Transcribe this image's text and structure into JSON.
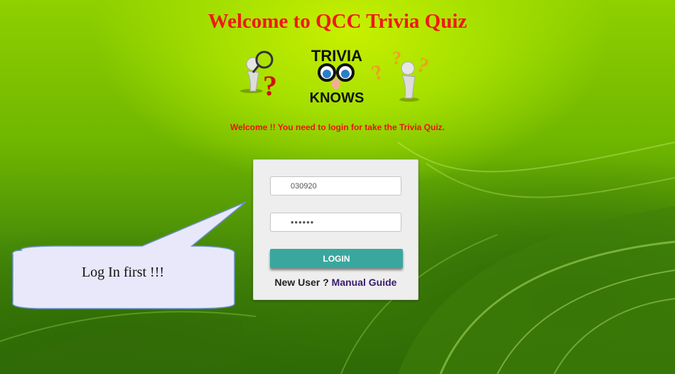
{
  "page": {
    "title": "Welcome to QCC Trivia Quiz",
    "notice": "Welcome !! You need to login for take the Trivia Quiz."
  },
  "logo": {
    "line1": "TRIVIA",
    "line2": "KNOWS",
    "left_icon": "magnifier-question-figure-icon",
    "right_icon": "thinking-question-figure-icon"
  },
  "login": {
    "username_value": "030920",
    "password_value": "••••••",
    "button_label": "LOGIN",
    "new_user_label": "New User ?",
    "manual_link": "Manual Guide"
  },
  "callout": {
    "text": "Log In first !!!"
  },
  "colors": {
    "title": "#f01818",
    "notice": "#ee1111",
    "button": "#3aa79e",
    "link": "#3a1a6e",
    "callout_fill": "#e8e8fa"
  }
}
